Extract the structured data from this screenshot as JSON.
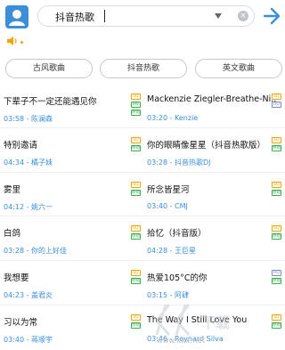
{
  "search": {
    "query": "抖音热歌",
    "clear_symbol": "×"
  },
  "tabs": [
    {
      "label": "古风歌曲"
    },
    {
      "label": "抖音热歌"
    },
    {
      "label": "英文歌曲"
    }
  ],
  "songs": [
    {
      "title": "下辈子不一定还能遇见你",
      "meta": "03:58 - 陈澜森",
      "badges": [
        "SQ",
        "MV",
        "原唱"
      ]
    },
    {
      "title": "Mackenzie Ziegler-Breathe-Ni...",
      "meta": "03:20 - Kenzie",
      "badges": [
        "SQ",
        "HQ"
      ]
    },
    {
      "title": "特别邀请",
      "meta": "04:34 - 橘子妹",
      "badges": [
        "SQ",
        "原唱"
      ]
    },
    {
      "title": "你的眼睛像星星（抖音热歌版）",
      "meta": "03:28 - 抖音热歌DJ",
      "badges": [
        "SQ",
        "原唱"
      ]
    },
    {
      "title": "雾里",
      "meta": "04:12 - 姚六一",
      "badges": [
        "SQ",
        "原唱"
      ]
    },
    {
      "title": "所念皆星河",
      "meta": "03:40 - CMJ",
      "badges": [
        "SQ",
        "原唱"
      ]
    },
    {
      "title": "白鸽",
      "meta": "03:28 - 你的上好佳",
      "badges": [
        "SQ",
        "原唱"
      ]
    },
    {
      "title": "拾忆（抖音版）",
      "meta": "04:28 - 王巨星",
      "badges": [
        "SQ",
        "原唱"
      ]
    },
    {
      "title": "我想要",
      "meta": "04:23 - 盖君炎",
      "badges": [
        "SQ",
        "原唱"
      ]
    },
    {
      "title": "热爱105°C的你",
      "meta": "03:15 - 阿肆",
      "badges": [
        "HQ",
        "原唱"
      ]
    },
    {
      "title": "习以为常",
      "meta": "03:40 - 蒋顺宇",
      "badges": [
        "SQ",
        "原唱"
      ]
    },
    {
      "title": "The Way I Still Love You",
      "meta": "03:46 - Reynard Silva",
      "badges": [
        "SQ",
        "原唱"
      ]
    }
  ],
  "watermark": {
    "text": "www.kkx.net"
  },
  "colors": {
    "accent": "#3a8fd8",
    "sq": "#f0a500",
    "mv": "#3cae4f"
  },
  "icons": {
    "avatar": "user-avatar-icon",
    "dropdown": "chevron-down-icon",
    "clear": "clear-icon",
    "go": "arrow-right-icon",
    "speaker": "speaker-icon"
  }
}
